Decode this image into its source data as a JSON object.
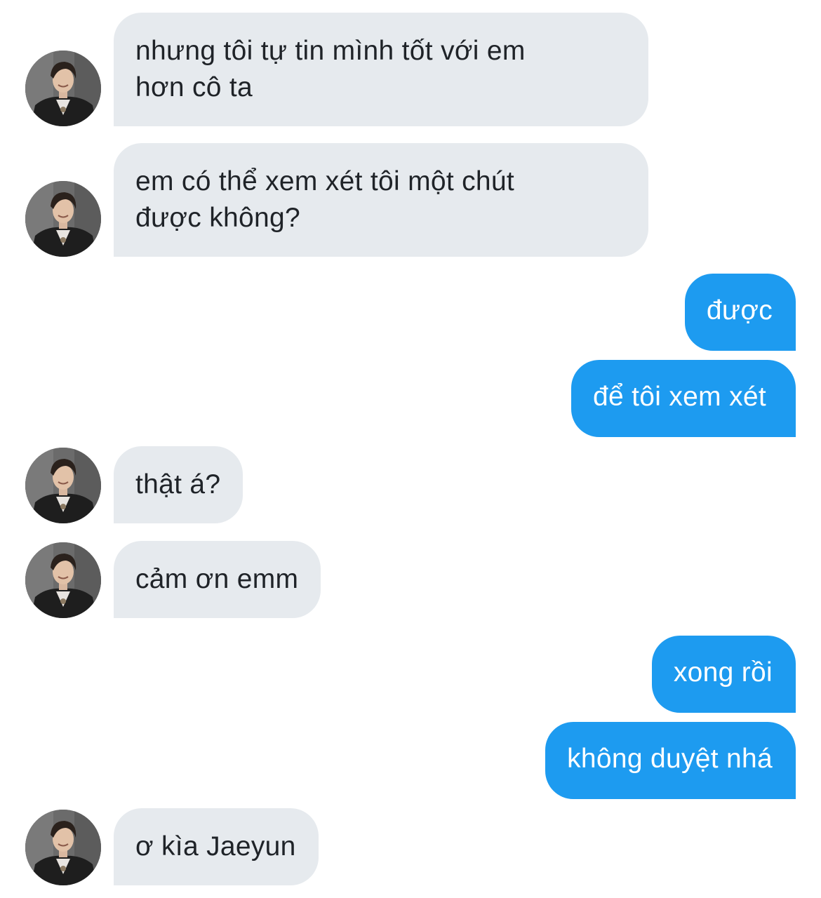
{
  "conversation": {
    "messages": [
      {
        "side": "in",
        "text": "nhưng tôi tự tin mình tốt với em\nhơn cô ta",
        "avatar_icon": "contact-avatar"
      },
      {
        "side": "in",
        "text": "em có thể xem xét tôi một chút\nđược không?",
        "avatar_icon": "contact-avatar"
      },
      {
        "side": "out",
        "text": "được"
      },
      {
        "side": "out",
        "text": "để tôi xem xét"
      },
      {
        "side": "in",
        "text": "thật á?",
        "avatar_icon": "contact-avatar"
      },
      {
        "side": "in",
        "text": "cảm ơn emm",
        "avatar_icon": "contact-avatar"
      },
      {
        "side": "out",
        "text": "xong rồi"
      },
      {
        "side": "out",
        "text": "không duyệt nhá"
      },
      {
        "side": "in",
        "text": "ơ kìa Jaeyun",
        "avatar_icon": "contact-avatar"
      }
    ]
  },
  "colors": {
    "incoming_bubble": "#e6eaee",
    "incoming_text": "#1f2328",
    "outgoing_bubble": "#1d9bf0",
    "outgoing_text": "#ffffff",
    "background": "#ffffff"
  }
}
